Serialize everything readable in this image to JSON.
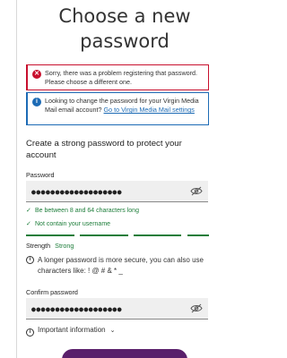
{
  "page": {
    "title": "Choose a new password"
  },
  "alerts": {
    "error_text": "Sorry, there was a problem registering that password. Please choose a different one.",
    "info_text": "Looking to change the password for your Virgin Media Mail email account?",
    "info_link": "Go to Virgin Media Mail settings",
    "error_icon": "close-icon",
    "info_icon": "info-icon"
  },
  "form": {
    "heading": "Create a strong password to protect your account",
    "password_label": "Password",
    "password_value": "●●●●●●●●●●●●●●●●●●●",
    "rules": [
      "Be between 8 and 64 characters long",
      "Not contain your username"
    ],
    "strength_label": "Strength",
    "strength_value": "Strong",
    "hint_text": "A longer password is more secure, you can also use characters like: ! @ # & * _",
    "confirm_label": "Confirm password",
    "confirm_value": "●●●●●●●●●●●●●●●●●●●",
    "important_label": "Important information"
  },
  "colors": {
    "error": "#c8102e",
    "info": "#1d6bb5",
    "success": "#1d7d3a",
    "button": "#5a1f6b"
  }
}
